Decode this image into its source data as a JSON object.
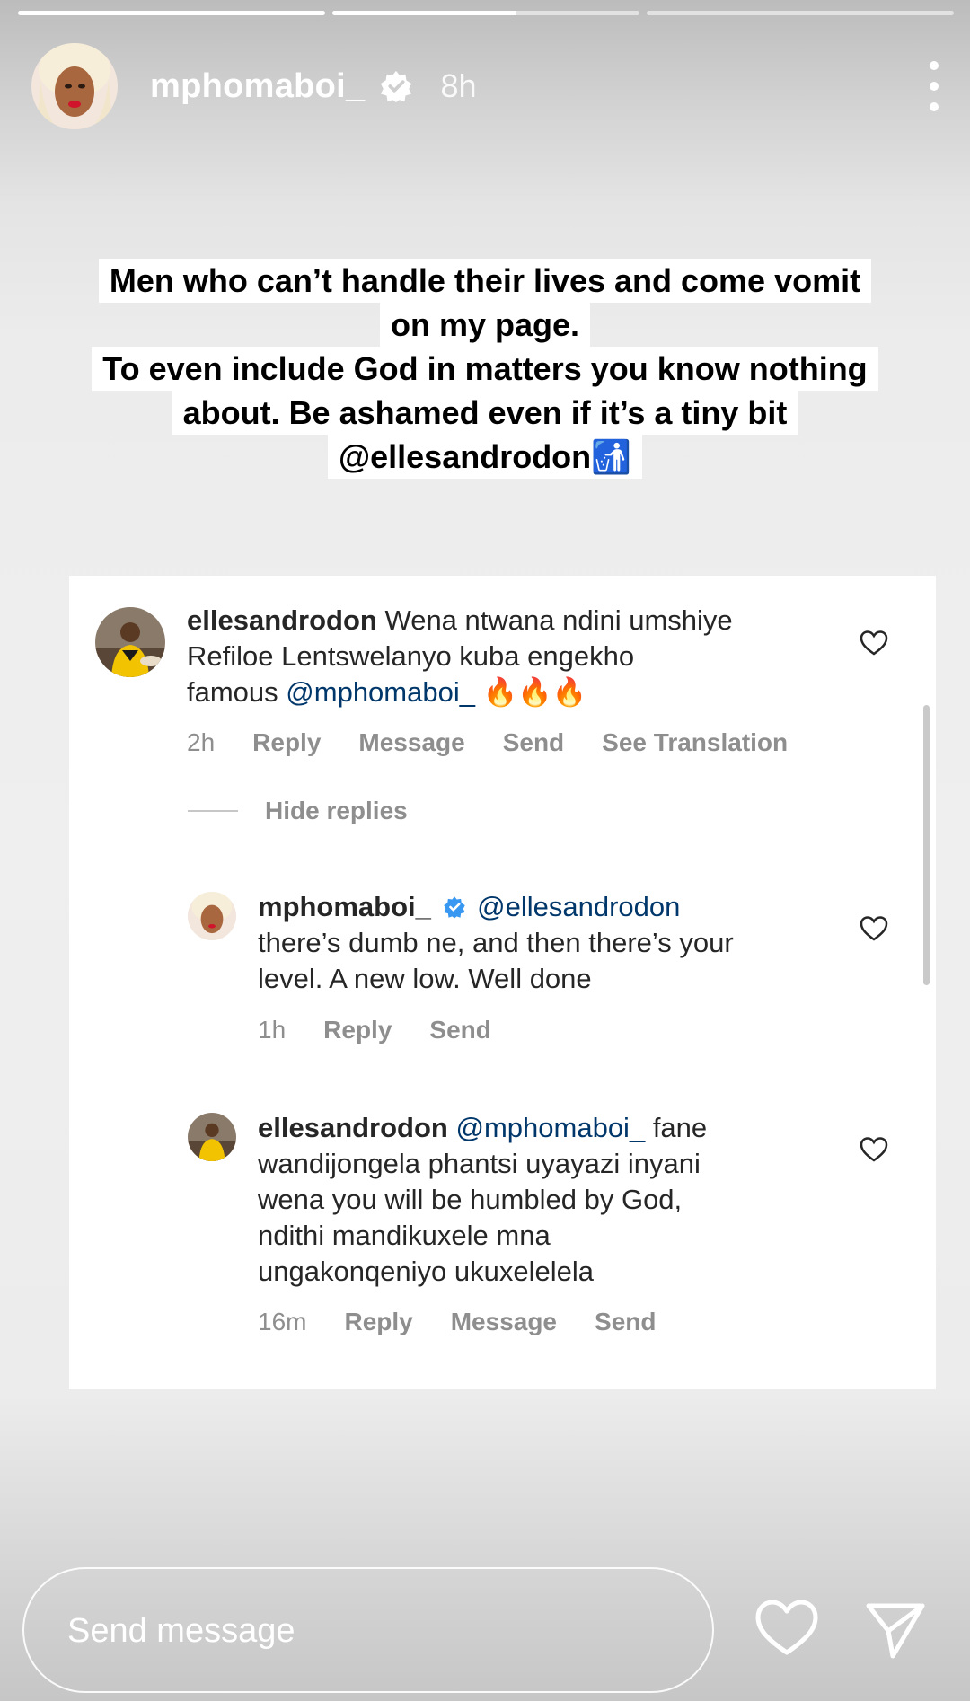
{
  "story": {
    "progress": [
      1.0,
      0.6,
      0.0
    ],
    "username": "mphomaboi_",
    "time": "8h",
    "caption_lines": [
      "Men who can’t handle their lives and come vomit",
      "on my page.",
      "To even include God in matters you know nothing",
      "about. Be ashamed even if it’s a tiny bit",
      "@ellesandrodon🚮"
    ]
  },
  "comments": [
    {
      "user": "ellesandrodon",
      "text_lines": [
        "Wena ntwana ndini umshiye",
        "Refiloe Lentswelanyo kuba engekho"
      ],
      "last_line_prefix": "famous ",
      "mention": "@mphomaboi_",
      "suffix": " 🔥🔥🔥",
      "time": "2h",
      "actions": [
        "Reply",
        "Message",
        "Send",
        "See Translation"
      ]
    },
    {
      "user": "mphomaboi_",
      "mention": "@ellesandrodon",
      "text_lines": [
        "there’s dumb ne, and then there’s your",
        "level. A new low. Well done"
      ],
      "time": "1h",
      "actions": [
        "Reply",
        "Send"
      ]
    },
    {
      "user": "ellesandrodon",
      "mention": "@mphomaboi_",
      "first_tail": " fane",
      "text_lines": [
        "wandijongela phantsi uyayazi inyani",
        "wena you will be humbled by God,",
        "ndithi mandikuxele mna",
        "ungakonqeniyo ukuxelelela"
      ],
      "time": "16m",
      "actions": [
        "Reply",
        "Message",
        "Send"
      ]
    }
  ],
  "hide_replies": "Hide replies",
  "footer": {
    "placeholder": "Send message"
  },
  "icons": {
    "verified": "verified-badge-icon",
    "more": "more-options-icon",
    "heart": "heart-icon",
    "send": "send-icon",
    "trash": "litter-emoji"
  },
  "colors": {
    "mention": "#00376b",
    "verified": "#3897f0",
    "meta": "#8e8e8e"
  }
}
